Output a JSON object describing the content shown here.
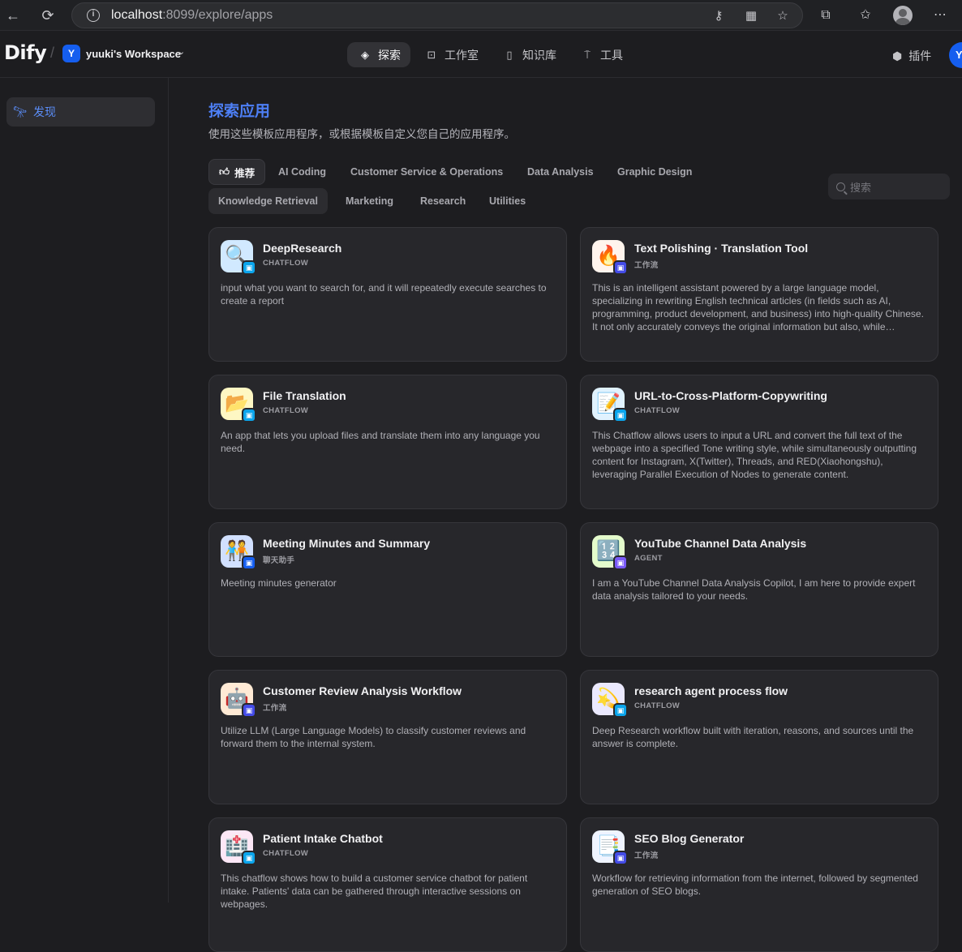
{
  "browser": {
    "url_host": "localhost",
    "url_rest": ":8099/explore/apps"
  },
  "header": {
    "logo": "Dify",
    "workspace_initial": "Y",
    "workspace_name": "yuuki's Workspace",
    "nav": [
      {
        "label": "探索",
        "icon": "compass-icon"
      },
      {
        "label": "工作室",
        "icon": "robot-icon"
      },
      {
        "label": "知识库",
        "icon": "book-icon"
      },
      {
        "label": "工具",
        "icon": "hammer-icon"
      }
    ],
    "plugins_label": "插件",
    "user_initial": "Y"
  },
  "sidebar": {
    "items": [
      {
        "label": "发现",
        "icon": "telescope-icon"
      }
    ]
  },
  "main": {
    "title": "探索应用",
    "subtitle": "使用这些模板应用程序，或根据模板自定义您自己的应用程序。",
    "search_placeholder": "搜索",
    "categories": [
      "推荐",
      "AI Coding",
      "Customer Service & Operations",
      "Data Analysis",
      "Graphic Design",
      "Knowledge Retrieval",
      "Marketing",
      "Research",
      "Utilities"
    ],
    "apps": [
      {
        "name": "DeepResearch",
        "type": "CHATFLOW",
        "icon": "🔍",
        "bg": "#d1e9ff",
        "badge": "#0ba5ec",
        "desc": "input what you want to search for, and it will repeatedly execute searches to create a report"
      },
      {
        "name": "Text Polishing · Translation Tool",
        "type": "工作流",
        "icon": "🔥",
        "bg": "#fff4ed",
        "badge": "#444ce7",
        "desc": "This is an intelligent assistant powered by a large language model, specializing in rewriting English technical articles (in fields such as AI, programming, product development, and business) into high-quality Chinese. It not only accurately conveys the original information but also, while preserving..."
      },
      {
        "name": "File Translation",
        "type": "CHATFLOW",
        "icon": "📂",
        "bg": "#fef7c3",
        "badge": "#0ba5ec",
        "desc": "An app that lets you upload files and translate them into any language you need."
      },
      {
        "name": "URL-to-Cross-Platform-Copywriting",
        "type": "CHATFLOW",
        "icon": "📝",
        "bg": "#e0f2fe",
        "badge": "#0ba5ec",
        "desc": "This Chatflow allows users to input a URL and convert the full text of the webpage into a specified Tone writing style, while simultaneously outputting content for Instagram, X(Twitter), Threads, and RED(Xiaohongshu), leveraging Parallel Execution of Nodes to generate content."
      },
      {
        "name": "Meeting Minutes and Summary",
        "type": "聊天助手",
        "icon": "🧑‍🤝‍🧑",
        "bg": "#d1e0ff",
        "badge": "#155eef",
        "desc": "Meeting minutes generator"
      },
      {
        "name": "YouTube Channel Data Analysis",
        "type": "AGENT",
        "icon": "🔢",
        "bg": "#e4fbcc",
        "badge": "#7a5af8",
        "desc": "I am a YouTube Channel Data Analysis Copilot, I am here to provide expert data analysis tailored to your needs."
      },
      {
        "name": "Customer Review Analysis Workflow",
        "type": "工作流",
        "icon": "🤖",
        "bg": "#ffead5",
        "badge": "#444ce7",
        "desc": "Utilize LLM (Large Language Models) to classify customer reviews and forward them to the internal system."
      },
      {
        "name": "research agent process flow",
        "type": "CHATFLOW",
        "icon": "💫",
        "bg": "#ebe9fe",
        "badge": "#0ba5ec",
        "desc": "Deep Research workflow built with iteration, reasons, and sources until the answer is complete."
      },
      {
        "name": "Patient Intake Chatbot",
        "type": "CHATFLOW",
        "icon": "🏥",
        "bg": "#fce7f6",
        "badge": "#0ba5ec",
        "desc": "This chatflow shows how to build a customer service chatbot for patient intake. Patients' data can be gathered through interactive sessions on webpages."
      },
      {
        "name": "SEO Blog Generator",
        "type": "工作流",
        "icon": "📑",
        "bg": "#eff4ff",
        "badge": "#444ce7",
        "desc": "Workflow for retrieving information from the internet, followed by segmented generation of SEO blogs."
      }
    ]
  }
}
